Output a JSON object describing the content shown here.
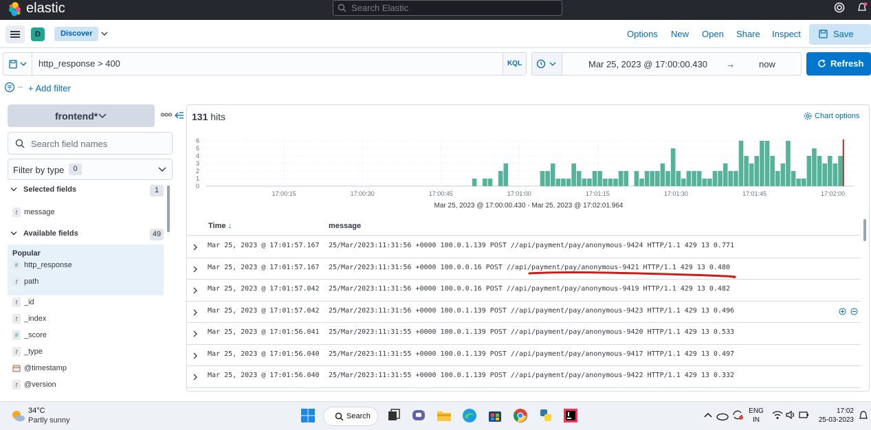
{
  "app": {
    "brand": "elastic",
    "search_placeholder": "Search Elastic"
  },
  "nav": {
    "space_initial": "D",
    "breadcrumb": "Discover",
    "links": [
      "Options",
      "New",
      "Open",
      "Share",
      "Inspect"
    ],
    "save_label": "Save"
  },
  "query": {
    "text": "http_response > 400",
    "language": "KQL"
  },
  "time": {
    "start": "Mar 25, 2023 @ 17:00:00.430",
    "arrow": "→",
    "end": "now",
    "refresh_label": "Refresh"
  },
  "filters": {
    "add_label": "+ Add filter"
  },
  "sidebar": {
    "index_pattern": "frontend*",
    "search_placeholder": "Search field names",
    "filter_by_type": "Filter by type",
    "filter_count": "0",
    "selected_header": "Selected fields",
    "selected_count": "1",
    "selected_fields": [
      {
        "type": "t",
        "name": "message"
      }
    ],
    "available_header": "Available fields",
    "available_count": "49",
    "popular_header": "Popular",
    "popular_fields": [
      {
        "type": "#",
        "name": "http_response"
      },
      {
        "type": "t",
        "name": "path"
      }
    ],
    "other_fields": [
      {
        "type": "t",
        "name": "_id"
      },
      {
        "type": "t",
        "name": "_index"
      },
      {
        "type": "#",
        "name": "_score"
      },
      {
        "type": "t",
        "name": "_type"
      },
      {
        "type": "cal",
        "name": "@timestamp"
      },
      {
        "type": "t",
        "name": "@version"
      }
    ]
  },
  "results": {
    "hits_count": "131",
    "hits_label": "hits",
    "chart_options_label": "Chart options",
    "date_range": "Mar 25, 2023 @ 17:00:00.430 - Mar 25, 2023 @ 17:02:01.964",
    "columns": [
      "Time",
      "message"
    ],
    "rows": [
      {
        "time": "Mar 25, 2023 @ 17:01:57.167",
        "message": "25/Mar/2023:11:31:56 +0000 100.0.1.139 POST //api/payment/pay/anonymous-9424 HTTP/1.1 429 13 0.771"
      },
      {
        "time": "Mar 25, 2023 @ 17:01:57.167",
        "message": "25/Mar/2023:11:31:56 +0000 100.0.0.16 POST //api/payment/pay/anonymous-9421 HTTP/1.1 429 13 0.480"
      },
      {
        "time": "Mar 25, 2023 @ 17:01:57.042",
        "message": "25/Mar/2023:11:31:56 +0000 100.0.0.16 POST //api/payment/pay/anonymous-9419 HTTP/1.1 429 13 0.482"
      },
      {
        "time": "Mar 25, 2023 @ 17:01:57.042",
        "message": "25/Mar/2023:11:31:56 +0000 100.0.1.139 POST //api/payment/pay/anonymous-9423 HTTP/1.1 429 13 0.496"
      },
      {
        "time": "Mar 25, 2023 @ 17:01:56.041",
        "message": "25/Mar/2023:11:31:55 +0000 100.0.1.139 POST //api/payment/pay/anonymous-9420 HTTP/1.1 429 13 0.533"
      },
      {
        "time": "Mar 25, 2023 @ 17:01:56.040",
        "message": "25/Mar/2023:11:31:55 +0000 100.0.1.139 POST //api/payment/pay/anonymous-9417 HTTP/1.1 429 13 0.497"
      },
      {
        "time": "Mar 25, 2023 @ 17:01:56.040",
        "message": "25/Mar/2023:11:31:55 +0000 100.0.1.139 POST //api/payment/pay/anonymous-9422 HTTP/1.1 429 13 0.332"
      }
    ]
  },
  "chart_data": {
    "type": "bar",
    "yticks": [
      "0",
      "1",
      "2",
      "3",
      "4",
      "5",
      "6"
    ],
    "ylim": [
      0,
      6
    ],
    "xticks": [
      "17:00:15",
      "17:00:30",
      "17:00:45",
      "17:01:00",
      "17:01:15",
      "17:01:30",
      "17:01:45",
      "17:02:00"
    ],
    "bar_color": "#54b399",
    "marker_color": "#bd271e",
    "bar_width_sec": 1,
    "buckets": [
      {
        "t": 51,
        "v": 1
      },
      {
        "t": 53,
        "v": 1
      },
      {
        "t": 54,
        "v": 1
      },
      {
        "t": 56,
        "v": 2
      },
      {
        "t": 57,
        "v": 3
      },
      {
        "t": 64,
        "v": 2
      },
      {
        "t": 65,
        "v": 2
      },
      {
        "t": 66,
        "v": 3
      },
      {
        "t": 67,
        "v": 1
      },
      {
        "t": 68,
        "v": 1
      },
      {
        "t": 69,
        "v": 1
      },
      {
        "t": 70,
        "v": 3
      },
      {
        "t": 71,
        "v": 2
      },
      {
        "t": 72,
        "v": 1
      },
      {
        "t": 73,
        "v": 1
      },
      {
        "t": 74,
        "v": 2
      },
      {
        "t": 75,
        "v": 2
      },
      {
        "t": 76,
        "v": 1
      },
      {
        "t": 77,
        "v": 1
      },
      {
        "t": 78,
        "v": 1
      },
      {
        "t": 79,
        "v": 2
      },
      {
        "t": 80,
        "v": 2
      },
      {
        "t": 82,
        "v": 2
      },
      {
        "t": 83,
        "v": 1
      },
      {
        "t": 84,
        "v": 2
      },
      {
        "t": 85,
        "v": 2
      },
      {
        "t": 86,
        "v": 2
      },
      {
        "t": 87,
        "v": 3
      },
      {
        "t": 88,
        "v": 2
      },
      {
        "t": 89,
        "v": 5
      },
      {
        "t": 90,
        "v": 2
      },
      {
        "t": 91,
        "v": 1
      },
      {
        "t": 92,
        "v": 2
      },
      {
        "t": 93,
        "v": 2
      },
      {
        "t": 94,
        "v": 2
      },
      {
        "t": 95,
        "v": 1
      },
      {
        "t": 96,
        "v": 1
      },
      {
        "t": 97,
        "v": 2
      },
      {
        "t": 98,
        "v": 2
      },
      {
        "t": 99,
        "v": 3
      },
      {
        "t": 100,
        "v": 2
      },
      {
        "t": 101,
        "v": 2
      },
      {
        "t": 102,
        "v": 6
      },
      {
        "t": 103,
        "v": 4
      },
      {
        "t": 104,
        "v": 3
      },
      {
        "t": 105,
        "v": 4
      },
      {
        "t": 106,
        "v": 6
      },
      {
        "t": 107,
        "v": 6
      },
      {
        "t": 108,
        "v": 4
      },
      {
        "t": 109,
        "v": 2
      },
      {
        "t": 110,
        "v": 3
      },
      {
        "t": 111,
        "v": 6
      },
      {
        "t": 112,
        "v": 2
      },
      {
        "t": 113,
        "v": 1
      },
      {
        "t": 114,
        "v": 1
      },
      {
        "t": 115,
        "v": 4
      },
      {
        "t": 116,
        "v": 5
      },
      {
        "t": 117,
        "v": 4
      },
      {
        "t": 118,
        "v": 3
      },
      {
        "t": 119,
        "v": 4
      },
      {
        "t": 120,
        "v": 3
      },
      {
        "t": 121,
        "v": 4
      }
    ],
    "now_marker_sec": 122
  },
  "taskbar": {
    "temperature": "34°C",
    "weather": "Partly sunny",
    "search_label": "Search",
    "lang_top": "ENG",
    "lang_bottom": "IN",
    "time": "17:02",
    "date": "25-03-2023"
  }
}
